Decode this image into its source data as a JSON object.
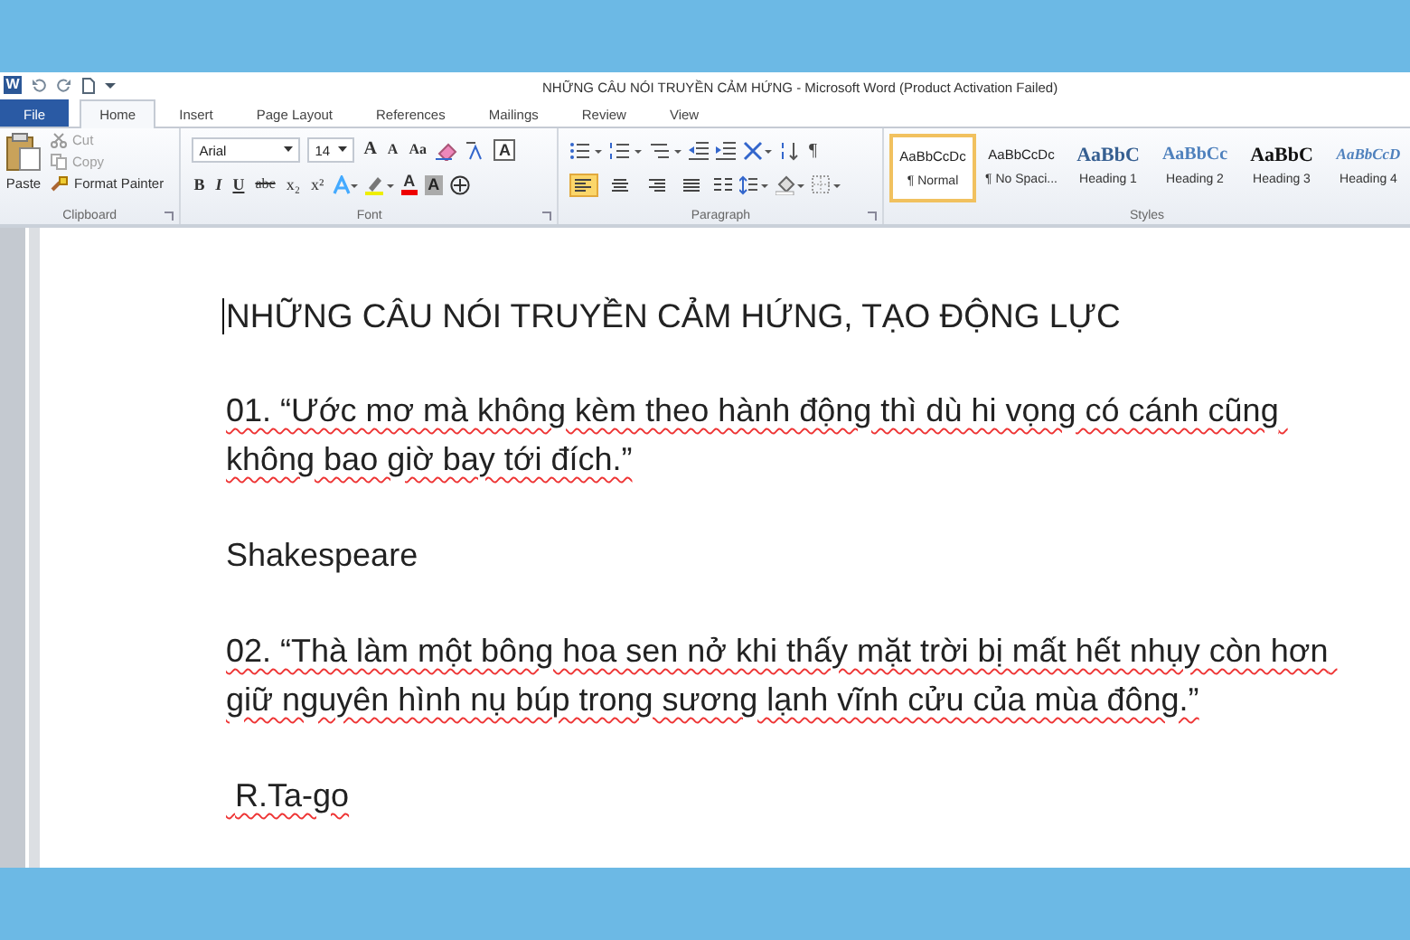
{
  "window": {
    "app_icon_letter": "W",
    "title": "NHỮNG CÂU NÓI TRUYỀN CẢM HỨNG  -  Microsoft Word (Product Activation Failed)"
  },
  "tabs": [
    {
      "label": "File",
      "kind": "file",
      "selected": false
    },
    {
      "label": "Home",
      "kind": "tab",
      "selected": true
    },
    {
      "label": "Insert",
      "kind": "tab",
      "selected": false
    },
    {
      "label": "Page Layout",
      "kind": "tab",
      "selected": false
    },
    {
      "label": "References",
      "kind": "tab",
      "selected": false
    },
    {
      "label": "Mailings",
      "kind": "tab",
      "selected": false
    },
    {
      "label": "Review",
      "kind": "tab",
      "selected": false
    },
    {
      "label": "View",
      "kind": "tab",
      "selected": false
    }
  ],
  "clipboard": {
    "label": "Clipboard",
    "paste": "Paste",
    "cut": "Cut",
    "copy": "Copy",
    "format_painter": "Format Painter",
    "cut_disabled": true,
    "copy_disabled": true
  },
  "font": {
    "label": "Font",
    "font_name": "Arial",
    "font_size": "14",
    "row1": [
      "A",
      "A",
      "Aa"
    ],
    "boxed_a": "A",
    "row2": [
      {
        "text": "B",
        "kind": "bold"
      },
      {
        "text": "I",
        "kind": "italic"
      },
      {
        "text": "U",
        "kind": "underline"
      },
      {
        "text": "abc",
        "kind": "strike"
      },
      {
        "text": "x₂",
        "kind": "plain"
      },
      {
        "text": "x²",
        "kind": "plain"
      }
    ],
    "color_a": "A",
    "shade_a": "A"
  },
  "paragraph": {
    "label": "Paragraph",
    "pilcrow": "¶",
    "alignments": [
      {
        "selected": true
      },
      {
        "selected": false
      },
      {
        "selected": false
      },
      {
        "selected": false
      }
    ]
  },
  "styles": {
    "label": "Styles",
    "items": [
      {
        "sample": "AaBbCcDc",
        "name": "¶ Normal",
        "kind": "normal",
        "selected": true
      },
      {
        "sample": "AaBbCcDc",
        "name": "¶ No Spaci...",
        "kind": "normal",
        "selected": false
      },
      {
        "sample": "AaBbC",
        "name": "Heading 1",
        "kind": "h1",
        "selected": false
      },
      {
        "sample": "AaBbCc",
        "name": "Heading 2",
        "kind": "h2",
        "selected": false
      },
      {
        "sample": "AaBbC",
        "name": "Heading 3",
        "kind": "h3",
        "selected": false
      },
      {
        "sample": "AaBbCcD",
        "name": "Heading 4",
        "kind": "h4",
        "selected": false
      }
    ]
  },
  "document": {
    "paragraphs": [
      {
        "text": "NHỮNG CÂU NÓI TRUYỀN CẢM HỨNG, TẠO ĐỘNG LỰC",
        "kind": "title",
        "spelling_marked": false
      },
      {
        "text": "01. “Ước mơ mà không kèm theo hành động thì dù hi vọng có cánh cũng không bao giờ bay tới đích.”",
        "kind": "quote",
        "spelling_marked": true
      },
      {
        "text": "Shakespeare",
        "kind": "author",
        "spelling_marked": false
      },
      {
        "text": "02. “Thà làm một bông hoa sen nở khi thấy mặt trời bị mất hết nhụy còn hơn giữ nguyên hình nụ búp trong sương lạnh vĩnh cửu của mùa đông.”",
        "kind": "quote",
        "spelling_marked": true
      },
      {
        "text": " R.Ta-go",
        "kind": "author",
        "spelling_marked": true
      }
    ]
  }
}
